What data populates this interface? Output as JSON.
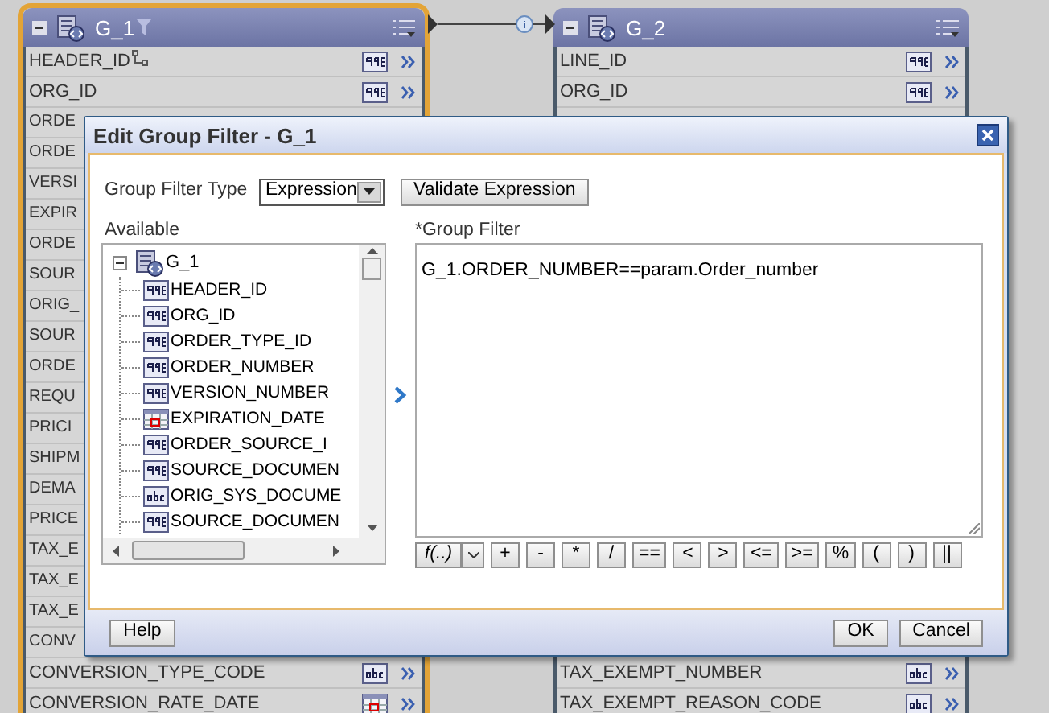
{
  "groups": [
    {
      "title": "G_1",
      "selected": true,
      "filtered": true,
      "rows_top": [
        {
          "label": "HEADER_ID",
          "kind": "number",
          "key": true
        },
        {
          "label": "ORG_ID",
          "kind": "number",
          "key": false
        },
        {
          "label": "ORDE"
        },
        {
          "label": "ORDE"
        },
        {
          "label": "VERSI"
        },
        {
          "label": "EXPIR"
        },
        {
          "label": "ORDE"
        },
        {
          "label": "SOUR"
        },
        {
          "label": "ORIG_"
        },
        {
          "label": "SOUR"
        },
        {
          "label": "ORDE"
        },
        {
          "label": "REQU"
        },
        {
          "label": "PRICI"
        },
        {
          "label": "SHIPM"
        },
        {
          "label": "DEMA"
        },
        {
          "label": "PRICE"
        },
        {
          "label": "TAX_E"
        },
        {
          "label": "TAX_E"
        },
        {
          "label": "TAX_E"
        },
        {
          "label": "CONV"
        },
        {
          "label": "CONVERSION_TYPE_CODE",
          "kind": "text",
          "key": false
        },
        {
          "label": "CONVERSION_RATE_DATE",
          "kind": "date",
          "key": false
        }
      ]
    },
    {
      "title": "G_2",
      "selected": false,
      "filtered": false,
      "rows_top": [
        {
          "label": "LINE_ID",
          "kind": "number",
          "key": false
        },
        {
          "label": "ORG_ID",
          "kind": "number",
          "key": false
        }
      ],
      "rows_bottom": [
        {
          "label": "TAX_EXEMPT_NUMBER",
          "kind": "text",
          "key": false
        },
        {
          "label": "TAX_EXEMPT_REASON_CODE",
          "kind": "text",
          "key": false
        }
      ]
    }
  ],
  "dialog": {
    "title": "Edit Group Filter - G_1",
    "filter_type_label": "Group Filter Type",
    "filter_type_value": "Expression",
    "validate_button": "Validate Expression",
    "available_label": "Available",
    "tree": [
      {
        "label": "G_1",
        "kind": "group",
        "expanded": true,
        "children": [
          {
            "label": "HEADER_ID",
            "kind": "number"
          },
          {
            "label": "ORG_ID",
            "kind": "number"
          },
          {
            "label": "ORDER_TYPE_ID",
            "kind": "number"
          },
          {
            "label": "ORDER_NUMBER",
            "kind": "number"
          },
          {
            "label": "VERSION_NUMBER",
            "kind": "number"
          },
          {
            "label": "EXPIRATION_DATE",
            "kind": "date"
          },
          {
            "label": "ORDER_SOURCE_I",
            "kind": "number"
          },
          {
            "label": "SOURCE_DOCUMEN",
            "kind": "number"
          },
          {
            "label": "ORIG_SYS_DOCUME",
            "kind": "text"
          },
          {
            "label": "SOURCE_DOCUMEN",
            "kind": "number"
          }
        ]
      }
    ],
    "filter_label": "*Group Filter",
    "filter_value": "G_1.ORDER_NUMBER==param.Order_number",
    "function_button": "f(..)",
    "operators": [
      "+",
      "-",
      "*",
      "/",
      "==",
      "<",
      ">",
      "<=",
      ">=",
      "%",
      "(",
      ")",
      "||"
    ],
    "help_button": "Help",
    "ok_button": "OK",
    "cancel_button": "Cancel"
  }
}
